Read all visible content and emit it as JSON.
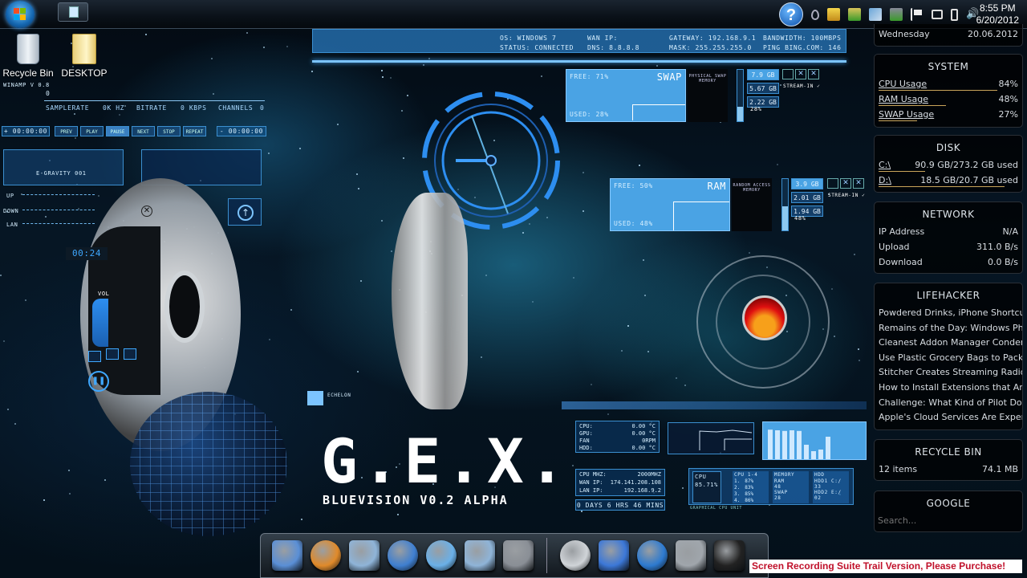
{
  "taskbar": {
    "start_label": "Start",
    "show_desktop_label": "Show desktop",
    "tray_icons": [
      "help-icon",
      "water-drop-icon",
      "printer-icon",
      "security-icon",
      "network-share-icon",
      "usb-safe-icon",
      "action-center-flag-icon",
      "network-icon",
      "battery-icon",
      "volume-icon"
    ],
    "time": "8:55 PM",
    "date": "6/20/2012"
  },
  "desktop_icons": [
    {
      "label": "Recycle Bin",
      "icon": "recycle-bin-icon"
    },
    {
      "label": "DESKTOP",
      "icon": "folder-icon"
    }
  ],
  "network_bar": {
    "os": "OS: WINDOWS 7",
    "status": "STATUS: CONNECTED",
    "wan_ip": "WAN IP:",
    "dns": "DNS: 8.8.8.8",
    "gateway": "GATEWAY: 192.168.9.1",
    "mask": "MASK: 255.255.255.0",
    "bandwidth": "BANDWIDTH: 100MBPS",
    "ping": "PING BING.COM: 146"
  },
  "winamp": {
    "title": "WINAMP V 0.8",
    "track": "0",
    "samplerate_label": "SAMPLERATE",
    "samplerate": "0K HZ",
    "bitrate_label": "BITRATE",
    "bitrate": "0 KBPS",
    "channels_label": "CHANNELS",
    "channels": "0",
    "elapsed": "+ 00:00:00",
    "remaining": "- 00:00:00",
    "buttons": [
      "PREV",
      "PLAY",
      "PAUSE",
      "NEXT",
      "STOP",
      "REPEAT"
    ]
  },
  "eq": {
    "label": "E-GRAVITY 001"
  },
  "netmeter": {
    "up": "UP",
    "down": "DOWN",
    "lan": "LAN"
  },
  "media_player": {
    "time": "00:24",
    "vol_label": "VOL"
  },
  "swap_panel": {
    "free": "FREE: 71%",
    "used": "USED: 28%",
    "title": "SWAP",
    "side_title": "PHYSICAL SWAP MEMORY",
    "values": [
      "7.9 GB",
      "5.67 GB",
      "2.22 GB"
    ],
    "percent": "28%",
    "status": "STREAM-IN ✓"
  },
  "ram_panel": {
    "free": "FREE: 50%",
    "used": "USED: 48%",
    "title": "RAM",
    "side_title": "RANDOM ACCESS MEMORY",
    "values": [
      "3.9 GB",
      "2.01 GB",
      "1.94 GB"
    ],
    "percent": "48%",
    "status": "STREAM-IN ✓"
  },
  "logo": {
    "title": "G.E.X.",
    "subtitle": "BLUEVISION V0.2 ALPHA",
    "echelon": "ECHELON"
  },
  "temps": [
    {
      "label": "CPU:",
      "value": "0.00 °C"
    },
    {
      "label": "GPU:",
      "value": "0.00 °C"
    },
    {
      "label": "FAN",
      "value": "0RPM"
    },
    {
      "label": "HDD:",
      "value": "0.00 °C"
    }
  ],
  "sysinfo": [
    {
      "label": "CPU MHZ:",
      "value": "2000MHZ"
    },
    {
      "label": "WAN IP:",
      "value": "174.141.208.108"
    },
    {
      "label": "LAN IP:",
      "value": "192.168.9.2"
    }
  ],
  "uptime": "0 DAYS 6 HRS 46 MINS",
  "cpu_monitor": {
    "cpu_label": "CPU",
    "cpu_value": "85.71%",
    "cores_title": "CPU 1-4",
    "cores": [
      {
        "n": "1.",
        "v": "87"
      },
      {
        "n": "2.",
        "v": "83"
      },
      {
        "n": "3.",
        "v": "85"
      },
      {
        "n": "4.",
        "v": "86"
      }
    ],
    "memory_title": "MEMORY",
    "ram_label": "RAM",
    "ram_value": "48",
    "swap_label": "SWAP",
    "swap_value": "28",
    "hdd_title": "HDD",
    "hdd1_label": "HDD1 C:/",
    "hdd1_value": "33",
    "hdd2_label": "HDD2 E:/",
    "hdd2_value": "02",
    "footer": "GRAPHICAL CPU UNIT",
    "bars": [
      0.92,
      0.9,
      0.88,
      0.9,
      0.88,
      0.45,
      0.25,
      0.3,
      0.7
    ]
  },
  "gadgets": {
    "date": {
      "day": "Wednesday",
      "date": "20.06.2012"
    },
    "system": {
      "title": "SYSTEM",
      "rows": [
        {
          "label": "CPU Usage",
          "value": "84%",
          "fraction": 0.84
        },
        {
          "label": "RAM Usage",
          "value": "48%",
          "fraction": 0.48
        },
        {
          "label": "SWAP Usage",
          "value": "27%",
          "fraction": 0.27
        }
      ]
    },
    "disk": {
      "title": "DISK",
      "rows": [
        {
          "label": "C:\\",
          "value": "90.9 GB/273.2 GB used",
          "fraction": 0.33
        },
        {
          "label": "D:\\",
          "value": "18.5 GB/20.7 GB used",
          "fraction": 0.89
        }
      ]
    },
    "network": {
      "title": "NETWORK",
      "rows": [
        {
          "label": "IP Address",
          "value": "N/A"
        },
        {
          "label": "Upload",
          "value": "311.0 B/s"
        },
        {
          "label": "Download",
          "value": "0.0 B/s"
        }
      ]
    },
    "lifehacker": {
      "title": "LIFEHACKER",
      "items": [
        "Powdered Drinks, iPhone Shortcut...",
        "Remains of the Day: Windows Pho...",
        "Cleanest Addon Manager Condens...",
        "Use Plastic Grocery Bags to Pack A...",
        "Stitcher Creates Streaming Radio S...",
        "How to Install Extensions that Are...",
        "Challenge: What Kind of Pilot Dou...",
        "Apple's Cloud Services Are Experie..."
      ]
    },
    "recycle": {
      "title": "RECYCLE BIN",
      "items": "12 items",
      "size": "74.1 MB"
    },
    "google": {
      "title": "GOOGLE",
      "placeholder": "Search..."
    }
  },
  "dock": {
    "items": [
      {
        "name": "finder-icon",
        "color": "#5a8fd6"
      },
      {
        "name": "firefox-icon",
        "color": "#e08a2a"
      },
      {
        "name": "documents-folder-icon",
        "color": "#8fb4d8"
      },
      {
        "name": "safari-icon",
        "color": "#3f7fd0"
      },
      {
        "name": "itunes-icon",
        "color": "#6ab0e8"
      },
      {
        "name": "pictures-folder-icon",
        "color": "#8fb4d8"
      },
      {
        "name": "system-preferences-icon",
        "color": "#8a8f96"
      },
      {
        "name": "dvd-player-icon",
        "color": "#d0d4d8"
      },
      {
        "name": "help-icon",
        "color": "#3c78d8"
      },
      {
        "name": "network-globe-icon",
        "color": "#2d7ad0"
      },
      {
        "name": "trash-icon",
        "color": "#a0a6ac"
      },
      {
        "name": "terminal-icon",
        "color": "#222"
      }
    ]
  },
  "watermark": "Screen Recording Suite Trail Version, Please Purchase!"
}
